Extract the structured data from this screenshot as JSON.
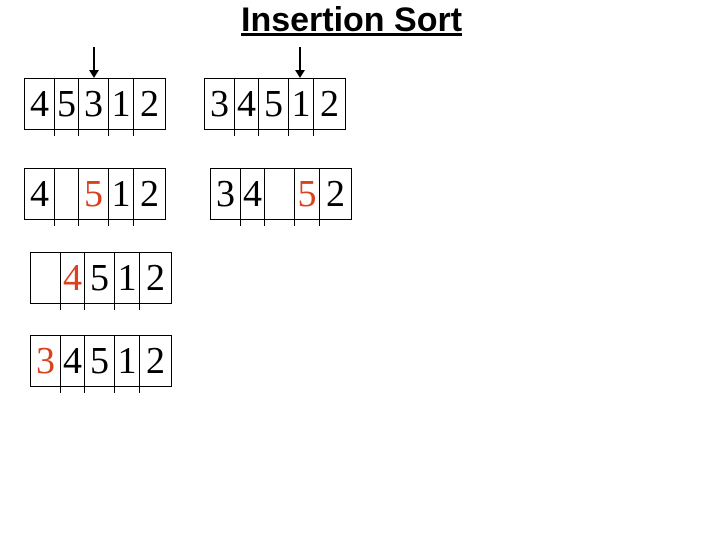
{
  "title": "Insertion Sort",
  "colors": {
    "highlight": "#d9421f",
    "text": "#000000"
  },
  "left_column": {
    "rows": [
      {
        "cells": [
          {
            "v": "4"
          },
          {
            "v": "5"
          },
          {
            "v": "3"
          },
          {
            "v": "1"
          },
          {
            "v": "2"
          }
        ],
        "pointer_index": 2
      },
      {
        "cells": [
          {
            "v": "4"
          },
          {
            "v": ""
          },
          {
            "v": "5",
            "highlight": true
          },
          {
            "v": "1"
          },
          {
            "v": "2"
          }
        ]
      },
      {
        "cells": [
          {
            "v": ""
          },
          {
            "v": "4",
            "highlight": true
          },
          {
            "v": "5"
          },
          {
            "v": "1"
          },
          {
            "v": "2"
          }
        ]
      },
      {
        "cells": [
          {
            "v": "3",
            "highlight": true
          },
          {
            "v": "4"
          },
          {
            "v": "5"
          },
          {
            "v": "1"
          },
          {
            "v": "2"
          }
        ]
      }
    ]
  },
  "right_column": {
    "rows": [
      {
        "cells": [
          {
            "v": "3"
          },
          {
            "v": "4"
          },
          {
            "v": "5"
          },
          {
            "v": "1"
          },
          {
            "v": "2"
          }
        ],
        "pointer_index": 3
      },
      {
        "cells": [
          {
            "v": "3"
          },
          {
            "v": "4"
          },
          {
            "v": ""
          },
          {
            "v": "5",
            "highlight": true
          },
          {
            "v": "2"
          }
        ]
      }
    ]
  }
}
